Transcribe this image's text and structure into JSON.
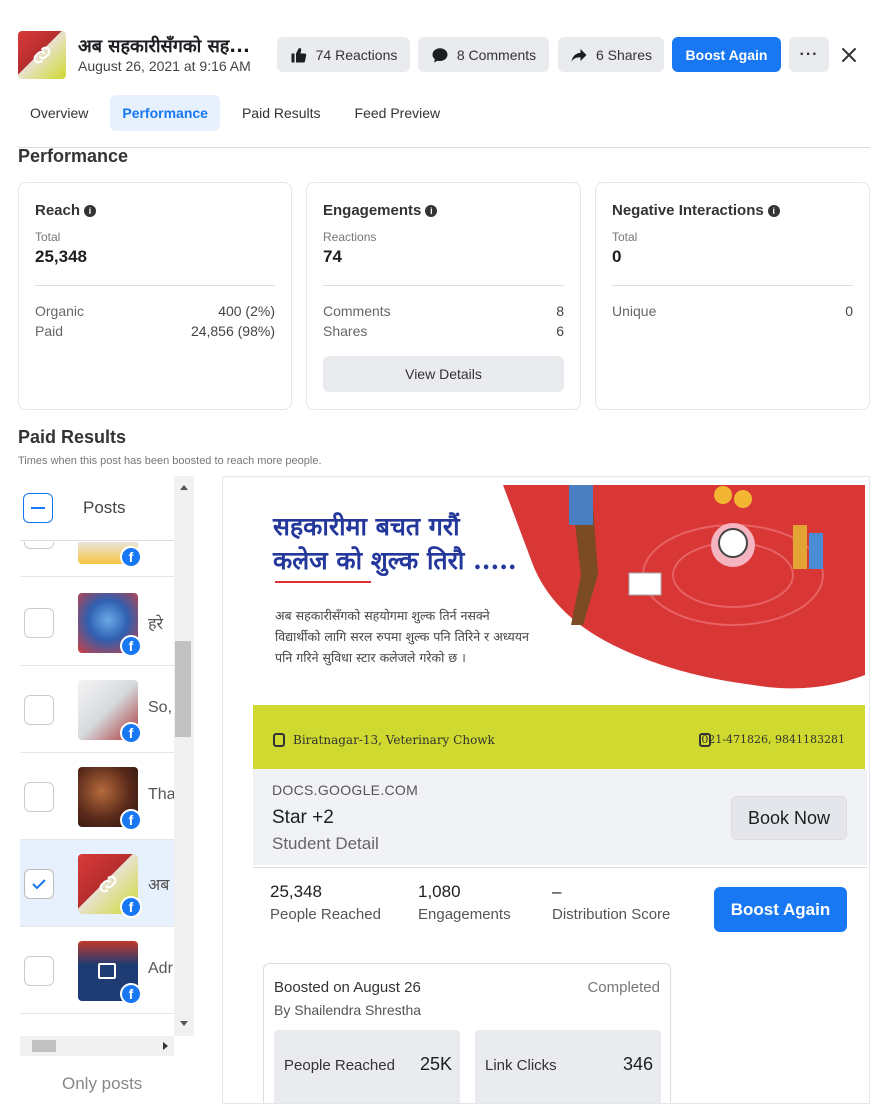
{
  "header": {
    "post_title": "अब सहकारीसँगको सह...",
    "post_date": "August 26, 2021 at 9:16 AM",
    "reactions_label": "74 Reactions",
    "comments_label": "8 Comments",
    "shares_label": "6 Shares",
    "boost_label": "Boost Again",
    "colors": {
      "accent": "#1877f2",
      "button_bg": "#e9ebee"
    }
  },
  "tabs": [
    {
      "label": "Overview",
      "active": false
    },
    {
      "label": "Performance",
      "active": true
    },
    {
      "label": "Paid Results",
      "active": false
    },
    {
      "label": "Feed Preview",
      "active": false
    }
  ],
  "performance": {
    "title": "Performance",
    "reach": {
      "title": "Reach",
      "total_label": "Total",
      "total_value": "25,348",
      "rows": [
        {
          "label": "Organic",
          "value": "400 (2%)"
        },
        {
          "label": "Paid",
          "value": "24,856 (98%)"
        }
      ]
    },
    "engagements": {
      "title": "Engagements",
      "total_label": "Reactions",
      "total_value": "74",
      "rows": [
        {
          "label": "Comments",
          "value": "8"
        },
        {
          "label": "Shares",
          "value": "6"
        }
      ],
      "button": "View Details"
    },
    "negative": {
      "title": "Negative Interactions",
      "total_label": "Total",
      "total_value": "0",
      "rows": [
        {
          "label": "Unique",
          "value": "0"
        }
      ]
    }
  },
  "paid_results": {
    "title": "Paid Results",
    "subtitle": "Times when this post has been boosted to reach more people.",
    "posts_header": "Posts",
    "items": [
      {
        "text": "हरे",
        "selected": false,
        "thumb": "blue-figure"
      },
      {
        "text": "So,",
        "selected": false,
        "thumb": "building"
      },
      {
        "text": "Tha",
        "selected": false,
        "thumb": "portrait"
      },
      {
        "text": "अब",
        "selected": true,
        "thumb": "red-link"
      },
      {
        "text": "Adr",
        "selected": false,
        "thumb": "admission"
      }
    ],
    "footer": "Only posts"
  },
  "preview": {
    "ad_title_line1": "सहकारीमा बचत गरौं",
    "ad_title_line2": "कलेज को शुल्क तिरौ .....",
    "ad_body": "अब सहकारीसँगको सहयोगमा शुल्क तिर्न नसक्ने विद्यार्थीको लागि सरल रुपमा शुल्क पनि तिरिने र अध्ययन पनि गरिने सुविधा स्टार कलेजले गरेको छ ।",
    "ad_address": "Biratnagar-13, Veterinary Chowk",
    "ad_phone": "021-471826, 9841183281",
    "link_domain": "DOCS.GOOGLE.COM",
    "link_title": "Star +2",
    "link_desc": "Student Detail",
    "book_label": "Book Now",
    "stats": [
      {
        "value": "25,348",
        "label": "People Reached"
      },
      {
        "value": "1,080",
        "label": "Engagements"
      },
      {
        "value": "–",
        "label": "Distribution Score"
      }
    ],
    "boost_label": "Boost Again",
    "boost_card": {
      "title": "Boosted on August 26",
      "status": "Completed",
      "by": "By Shailendra Shrestha",
      "metrics": [
        {
          "label": "People Reached",
          "value": "25K"
        },
        {
          "label": "Link Clicks",
          "value": "346"
        }
      ]
    }
  }
}
